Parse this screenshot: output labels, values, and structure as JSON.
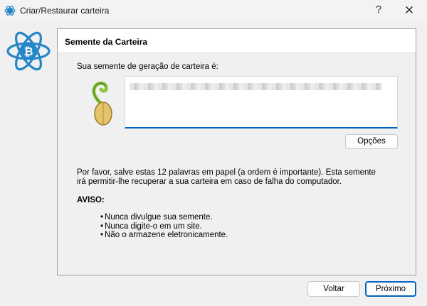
{
  "window": {
    "title": "Criar/Restaurar carteira",
    "help_glyph": "?",
    "close_glyph": "✕"
  },
  "panel": {
    "heading": "Semente da Carteira",
    "prompt": "Sua semente de geração de carteira é:",
    "options_label": "Opções",
    "info": "Por favor, salve estas 12 palavras em papel (a ordem é importante). Esta semente irá permitir-lhe recuperar a sua carteira em caso de falha do computador.",
    "warning_title": "AVISO:",
    "warnings": [
      "Nunca divulgue sua semente.",
      "Nunca digite-o em um site.",
      "Não o armazene eletronicamente."
    ]
  },
  "footer": {
    "back_label": "Voltar",
    "next_label": "Próximo"
  },
  "icons": {
    "app": "electrum-bitcoin-icon",
    "logo": "electrum-bitcoin-logo",
    "seed": "sprouting-seed-icon"
  },
  "colors": {
    "accent": "#0067c0",
    "logo_blue": "#2586c8"
  }
}
